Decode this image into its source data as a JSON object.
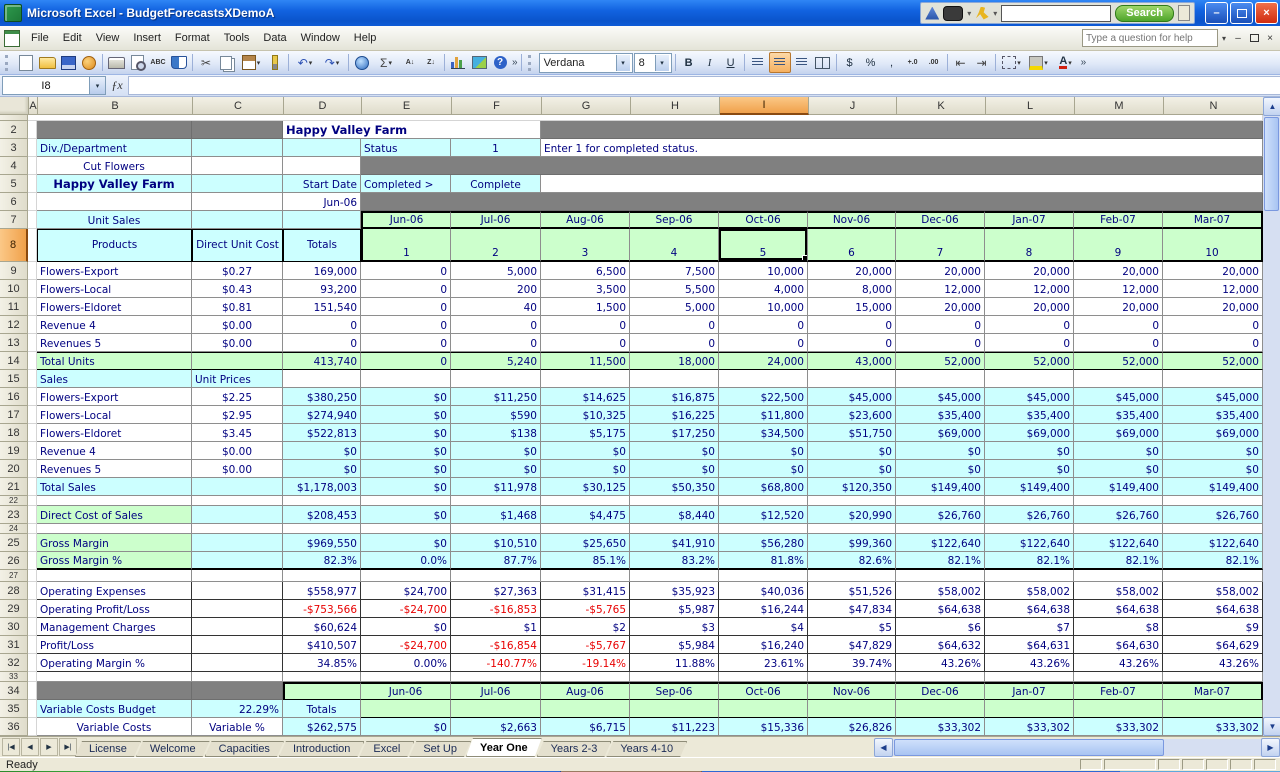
{
  "window": {
    "title": "Microsoft Excel - BudgetForecastsXDemoA",
    "search_button": "Search"
  },
  "menu": {
    "items": [
      "File",
      "Edit",
      "View",
      "Insert",
      "Format",
      "Tools",
      "Data",
      "Window",
      "Help"
    ],
    "help_placeholder": "Type a question for help"
  },
  "toolbar": {
    "font_name": "Verdana",
    "font_size": "8"
  },
  "icons": {
    "cut": "✂",
    "autosum": "Σ",
    "undo": "↶",
    "redo": "↷",
    "sort_asc": "A↓",
    "sort_desc": "Z↓",
    "help": "?",
    "spelling": "ABC",
    "bold": "B",
    "italic": "I",
    "underline": "U",
    "currency": "$",
    "percent": "%",
    "comma": ",",
    "inc_decimal": "+.0",
    "dec_decimal": ".00",
    "dec_indent": "⇤",
    "inc_indent": "⇥",
    "fx": "ƒx",
    "font_color_letter": "A",
    "chevron": "»",
    "minimize": "–",
    "close": "×",
    "up": "▲",
    "down": "▼",
    "left": "◀",
    "right": "▶",
    "first_tab": "|◀",
    "prev_tab": "◀",
    "next_tab": "▶",
    "last_tab": "▶|",
    "dropdown": "▾"
  },
  "formula_bar": {
    "name_box": "I8",
    "formula": ""
  },
  "grid": {
    "columns": [
      [
        "A",
        9
      ],
      [
        "B",
        155
      ],
      [
        "C",
        91
      ],
      [
        "D",
        78
      ],
      [
        "E",
        90
      ],
      [
        "F",
        90
      ],
      [
        "G",
        89
      ],
      [
        "H",
        89
      ],
      [
        "I",
        89
      ],
      [
        "J",
        88
      ],
      [
        "K",
        89
      ],
      [
        "L",
        89
      ],
      [
        "M",
        89
      ],
      [
        "N",
        100
      ]
    ],
    "selected_col": "I",
    "selected_row": 8,
    "selected_cell": "I8",
    "rows": [
      {
        "n": 1,
        "h": 6,
        "cells": [
          {
            "c": "A:N",
            "cls": "lite"
          }
        ]
      },
      {
        "n": 2,
        "h": 18,
        "cells": [
          {
            "c": "B",
            "bg": "gy"
          },
          {
            "c": "C",
            "bg": "gy"
          },
          {
            "c": "D:F",
            "t": "Happy Valley Farm",
            "b": 1,
            "al": "l"
          },
          {
            "c": "G:N",
            "bg": "gy"
          }
        ]
      },
      {
        "n": 3,
        "h": 18,
        "cells": [
          {
            "c": "B",
            "t": "Div./Department",
            "bg": "cy"
          },
          {
            "c": "C",
            "bg": "cy"
          },
          {
            "c": "D",
            "bg": "cy"
          },
          {
            "c": "E",
            "t": "Status",
            "bg": "cy",
            "al": "l"
          },
          {
            "c": "F",
            "t": "1",
            "bg": "cy",
            "al": "c"
          },
          {
            "c": "G:N",
            "t": "Enter 1 for completed status.",
            "al": "l"
          }
        ]
      },
      {
        "n": 4,
        "h": 18,
        "cells": [
          {
            "c": "B",
            "t": "Cut Flowers",
            "al": "c"
          },
          {
            "c": "C"
          },
          {
            "c": "D"
          },
          {
            "c": "E:N",
            "bg": "gy"
          }
        ]
      },
      {
        "n": 5,
        "h": 18,
        "cells": [
          {
            "c": "B",
            "t": "Happy Valley Farm",
            "b": 1,
            "bg": "cy",
            "al": "c"
          },
          {
            "c": "C",
            "bg": "cy"
          },
          {
            "c": "D",
            "t": "Start Date",
            "bg": "cy"
          },
          {
            "c": "E",
            "t": "Completed >",
            "bg": "cy",
            "al": "l"
          },
          {
            "c": "F",
            "t": "Complete",
            "bg": "cy",
            "al": "c"
          },
          {
            "c": "G:N"
          }
        ]
      },
      {
        "n": 6,
        "h": 18,
        "cells": [
          {
            "c": "B"
          },
          {
            "c": "C"
          },
          {
            "c": "D",
            "t": "Jun-06"
          },
          {
            "c": "E:N",
            "bg": "gy"
          }
        ]
      },
      {
        "n": 7,
        "h": 18,
        "cells": [
          {
            "c": "B",
            "t": "Unit Sales",
            "bg": "cy",
            "al": "c"
          },
          {
            "c": "C",
            "bg": "cy"
          },
          {
            "c": "D",
            "bg": "cy"
          },
          {
            "c": "E",
            "t": "Jun-06",
            "bg": "gn",
            "al": "c"
          },
          {
            "c": "F",
            "t": "Jul-06",
            "bg": "gn",
            "al": "c"
          },
          {
            "c": "G",
            "t": "Aug-06",
            "bg": "gn",
            "al": "c"
          },
          {
            "c": "H",
            "t": "Sep-06",
            "bg": "gn",
            "al": "c"
          },
          {
            "c": "I",
            "t": "Oct-06",
            "bg": "gn",
            "al": "c"
          },
          {
            "c": "J",
            "t": "Nov-06",
            "bg": "gn",
            "al": "c"
          },
          {
            "c": "K",
            "t": "Dec-06",
            "bg": "gn",
            "al": "c"
          },
          {
            "c": "L",
            "t": "Jan-07",
            "bg": "gn",
            "al": "c"
          },
          {
            "c": "M",
            "t": "Feb-07",
            "bg": "gn",
            "al": "c"
          },
          {
            "c": "N",
            "t": "Mar-07",
            "bg": "gn",
            "al": "c"
          }
        ]
      },
      {
        "n": 8,
        "h": 33,
        "cells": [
          {
            "c": "B",
            "t": "Products",
            "bg": "cy",
            "al": "c"
          },
          {
            "c": "C",
            "t": "Direct Unit Cost",
            "bg": "cy",
            "al": "c"
          },
          {
            "c": "D",
            "t": "Totals",
            "bg": "cy",
            "al": "c"
          },
          {
            "c": "E",
            "t": "1",
            "bg": "gn",
            "al": "c"
          },
          {
            "c": "F",
            "t": "2",
            "bg": "gn",
            "al": "c"
          },
          {
            "c": "G",
            "t": "3",
            "bg": "gn",
            "al": "c"
          },
          {
            "c": "H",
            "t": "4",
            "bg": "gn",
            "al": "c"
          },
          {
            "c": "I",
            "t": "5",
            "bg": "gn",
            "al": "c",
            "sel": 1
          },
          {
            "c": "J",
            "t": "6",
            "bg": "gn",
            "al": "c"
          },
          {
            "c": "K",
            "t": "7",
            "bg": "gn",
            "al": "c"
          },
          {
            "c": "L",
            "t": "8",
            "bg": "gn",
            "al": "c"
          },
          {
            "c": "M",
            "t": "9",
            "bg": "gn",
            "al": "c"
          },
          {
            "c": "N",
            "t": "10",
            "bg": "gn",
            "al": "c"
          }
        ]
      },
      {
        "n": 9,
        "h": 18,
        "lbl": "Flowers-Export",
        "cv": "$0.27",
        "v": [
          "169,000",
          "0",
          "5,000",
          "6,500",
          "7,500",
          "10,000",
          "20,000",
          "20,000",
          "20,000",
          "20,000",
          "20,000"
        ]
      },
      {
        "n": 10,
        "h": 18,
        "lbl": "Flowers-Local",
        "cv": "$0.43",
        "v": [
          "93,200",
          "0",
          "200",
          "3,500",
          "5,500",
          "4,000",
          "8,000",
          "12,000",
          "12,000",
          "12,000",
          "12,000"
        ]
      },
      {
        "n": 11,
        "h": 18,
        "lbl": "Flowers-Eldoret",
        "cv": "$0.81",
        "v": [
          "151,540",
          "0",
          "40",
          "1,500",
          "5,000",
          "10,000",
          "15,000",
          "20,000",
          "20,000",
          "20,000",
          "20,000"
        ]
      },
      {
        "n": 12,
        "h": 18,
        "lbl": "Revenue 4",
        "cv": "$0.00",
        "v": [
          "0",
          "0",
          "0",
          "0",
          "0",
          "0",
          "0",
          "0",
          "0",
          "0",
          "0"
        ]
      },
      {
        "n": 13,
        "h": 18,
        "lbl": "Revenues 5",
        "cv": "$0.00",
        "v": [
          "0",
          "0",
          "0",
          "0",
          "0",
          "0",
          "0",
          "0",
          "0",
          "0",
          "0"
        ]
      },
      {
        "n": 14,
        "h": 18,
        "lbl": "Total Units",
        "lbg": "gn",
        "cv": "",
        "cbg": "gn",
        "vbg": "gn",
        "v": [
          "413,740",
          "0",
          "5,240",
          "11,500",
          "18,000",
          "24,000",
          "43,000",
          "52,000",
          "52,000",
          "52,000",
          "52,000"
        ]
      },
      {
        "n": 15,
        "h": 18,
        "cells": [
          {
            "c": "B",
            "t": "Sales",
            "bg": "cy",
            "al": "l"
          },
          {
            "c": "C",
            "t": "Unit Prices",
            "bg": "cy",
            "al": "l"
          }
        ],
        "fill": "D:N"
      },
      {
        "n": 16,
        "h": 18,
        "lbl": "Flowers-Export",
        "cv": "$2.25",
        "vbg": "cy",
        "v": [
          "$380,250",
          "$0",
          "$11,250",
          "$14,625",
          "$16,875",
          "$22,500",
          "$45,000",
          "$45,000",
          "$45,000",
          "$45,000",
          "$45,000"
        ]
      },
      {
        "n": 17,
        "h": 18,
        "lbl": "Flowers-Local",
        "cv": "$2.95",
        "vbg": "cy",
        "v": [
          "$274,940",
          "$0",
          "$590",
          "$10,325",
          "$16,225",
          "$11,800",
          "$23,600",
          "$35,400",
          "$35,400",
          "$35,400",
          "$35,400"
        ]
      },
      {
        "n": 18,
        "h": 18,
        "lbl": "Flowers-Eldoret",
        "cv": "$3.45",
        "vbg": "cy",
        "v": [
          "$522,813",
          "$0",
          "$138",
          "$5,175",
          "$17,250",
          "$34,500",
          "$51,750",
          "$69,000",
          "$69,000",
          "$69,000",
          "$69,000"
        ]
      },
      {
        "n": 19,
        "h": 18,
        "lbl": "Revenue 4",
        "cv": "$0.00",
        "vbg": "cy",
        "v": [
          "$0",
          "$0",
          "$0",
          "$0",
          "$0",
          "$0",
          "$0",
          "$0",
          "$0",
          "$0",
          "$0"
        ]
      },
      {
        "n": 20,
        "h": 18,
        "lbl": "Revenues 5",
        "cv": "$0.00",
        "vbg": "cy",
        "v": [
          "$0",
          "$0",
          "$0",
          "$0",
          "$0",
          "$0",
          "$0",
          "$0",
          "$0",
          "$0",
          "$0"
        ]
      },
      {
        "n": 21,
        "h": 18,
        "lbl": "Total Sales",
        "lbg": "cy",
        "cv": "",
        "cbg": "cy",
        "vbg": "cy",
        "v": [
          "$1,178,003",
          "$0",
          "$11,978",
          "$30,125",
          "$50,350",
          "$68,800",
          "$120,350",
          "$149,400",
          "$149,400",
          "$149,400",
          "$149,400"
        ]
      },
      {
        "n": 22,
        "h": 10,
        "fill": "B:N"
      },
      {
        "n": 23,
        "h": 18,
        "lbl": "Direct Cost of Sales",
        "lbg": "gn",
        "cv": "",
        "cbg": "cy",
        "vbg": "cy",
        "v": [
          "$208,453",
          "$0",
          "$1,468",
          "$4,475",
          "$8,440",
          "$12,520",
          "$20,990",
          "$26,760",
          "$26,760",
          "$26,760",
          "$26,760"
        ]
      },
      {
        "n": 24,
        "h": 10,
        "fill": "B:N"
      },
      {
        "n": 25,
        "h": 18,
        "lbl": "Gross Margin",
        "lbg": "gn",
        "cv": "",
        "cbg": "cy",
        "vbg": "cy",
        "v": [
          "$969,550",
          "$0",
          "$10,510",
          "$25,650",
          "$41,910",
          "$56,280",
          "$99,360",
          "$122,640",
          "$122,640",
          "$122,640",
          "$122,640"
        ]
      },
      {
        "n": 26,
        "h": 18,
        "lbl": "Gross Margin %",
        "lbg": "gn",
        "cv": "",
        "cbg": "cy",
        "vbg": "cy",
        "v": [
          "82.3%",
          "0.0%",
          "87.7%",
          "85.1%",
          "83.2%",
          "81.8%",
          "82.6%",
          "82.1%",
          "82.1%",
          "82.1%",
          "82.1%"
        ]
      },
      {
        "n": 27,
        "h": 12,
        "fill": "B:N"
      },
      {
        "n": 28,
        "h": 18,
        "lbl": "Operating Expenses",
        "cv": "",
        "v": [
          "$558,977",
          "$24,700",
          "$27,363",
          "$31,415",
          "$35,923",
          "$40,036",
          "$51,526",
          "$58,002",
          "$58,002",
          "$58,002",
          "$58,002"
        ]
      },
      {
        "n": 29,
        "h": 18,
        "lbl": "Operating Profit/Loss",
        "cv": "",
        "v": [
          "-$753,566",
          "-$24,700",
          "-$16,853",
          "-$5,765",
          "$5,987",
          "$16,244",
          "$47,834",
          "$64,638",
          "$64,638",
          "$64,638",
          "$64,638"
        ]
      },
      {
        "n": 30,
        "h": 18,
        "lbl": "Management Charges",
        "cv": "",
        "v": [
          "$60,624",
          "$0",
          "$1",
          "$2",
          "$3",
          "$4",
          "$5",
          "$6",
          "$7",
          "$8",
          "$9"
        ]
      },
      {
        "n": 31,
        "h": 18,
        "lbl": "Profit/Loss",
        "cv": "",
        "v": [
          "$410,507",
          "-$24,700",
          "-$16,854",
          "-$5,767",
          "$5,984",
          "$16,240",
          "$47,829",
          "$64,632",
          "$64,631",
          "$64,630",
          "$64,629"
        ]
      },
      {
        "n": 32,
        "h": 18,
        "lbl": "Operating Margin %",
        "cv": "",
        "v": [
          "34.85%",
          "0.00%",
          "-140.77%",
          "-19.14%",
          "11.88%",
          "23.61%",
          "39.74%",
          "43.26%",
          "43.26%",
          "43.26%",
          "43.26%"
        ]
      },
      {
        "n": 33,
        "h": 10,
        "fill": "B:N"
      },
      {
        "n": 34,
        "h": 18,
        "cells": [
          {
            "c": "B",
            "bg": "gy"
          },
          {
            "c": "C",
            "bg": "gy"
          },
          {
            "c": "D",
            "bg": "gn"
          },
          {
            "c": "E",
            "t": "Jun-06",
            "bg": "gn",
            "al": "c"
          },
          {
            "c": "F",
            "t": "Jul-06",
            "bg": "gn",
            "al": "c"
          },
          {
            "c": "G",
            "t": "Aug-06",
            "bg": "gn",
            "al": "c"
          },
          {
            "c": "H",
            "t": "Sep-06",
            "bg": "gn",
            "al": "c"
          },
          {
            "c": "I",
            "t": "Oct-06",
            "bg": "gn",
            "al": "c"
          },
          {
            "c": "J",
            "t": "Nov-06",
            "bg": "gn",
            "al": "c"
          },
          {
            "c": "K",
            "t": "Dec-06",
            "bg": "gn",
            "al": "c"
          },
          {
            "c": "L",
            "t": "Jan-07",
            "bg": "gn",
            "al": "c"
          },
          {
            "c": "M",
            "t": "Feb-07",
            "bg": "gn",
            "al": "c"
          },
          {
            "c": "N",
            "t": "Mar-07",
            "bg": "gn",
            "al": "c"
          }
        ]
      },
      {
        "n": 35,
        "h": 18,
        "cells": [
          {
            "c": "B",
            "t": "Variable Costs Budget",
            "bg": "cy",
            "al": "l"
          },
          {
            "c": "C",
            "t": "22.29%",
            "bg": "cy",
            "al": "r"
          },
          {
            "c": "D",
            "t": "Totals",
            "bg": "cy",
            "al": "c"
          }
        ],
        "fill": "E:N",
        "fillBg": "gn"
      },
      {
        "n": 36,
        "h": 18,
        "lbl": "Variable Costs",
        "lal": "c",
        "cv": "Variable %",
        "vbg": "cy",
        "v": [
          "$262,575",
          "$0",
          "$2,663",
          "$6,715",
          "$11,223",
          "$15,336",
          "$26,826",
          "$33,302",
          "$33,302",
          "$33,302",
          "$33,302"
        ]
      }
    ]
  },
  "sheet_tabs": {
    "tabs": [
      "License",
      "Welcome",
      "Capacities",
      "Introduction",
      "Excel",
      "Set Up",
      "Year One",
      "Years 2-3",
      "Years 4-10"
    ],
    "active": "Year One"
  },
  "status_bar": {
    "text": "Ready"
  }
}
